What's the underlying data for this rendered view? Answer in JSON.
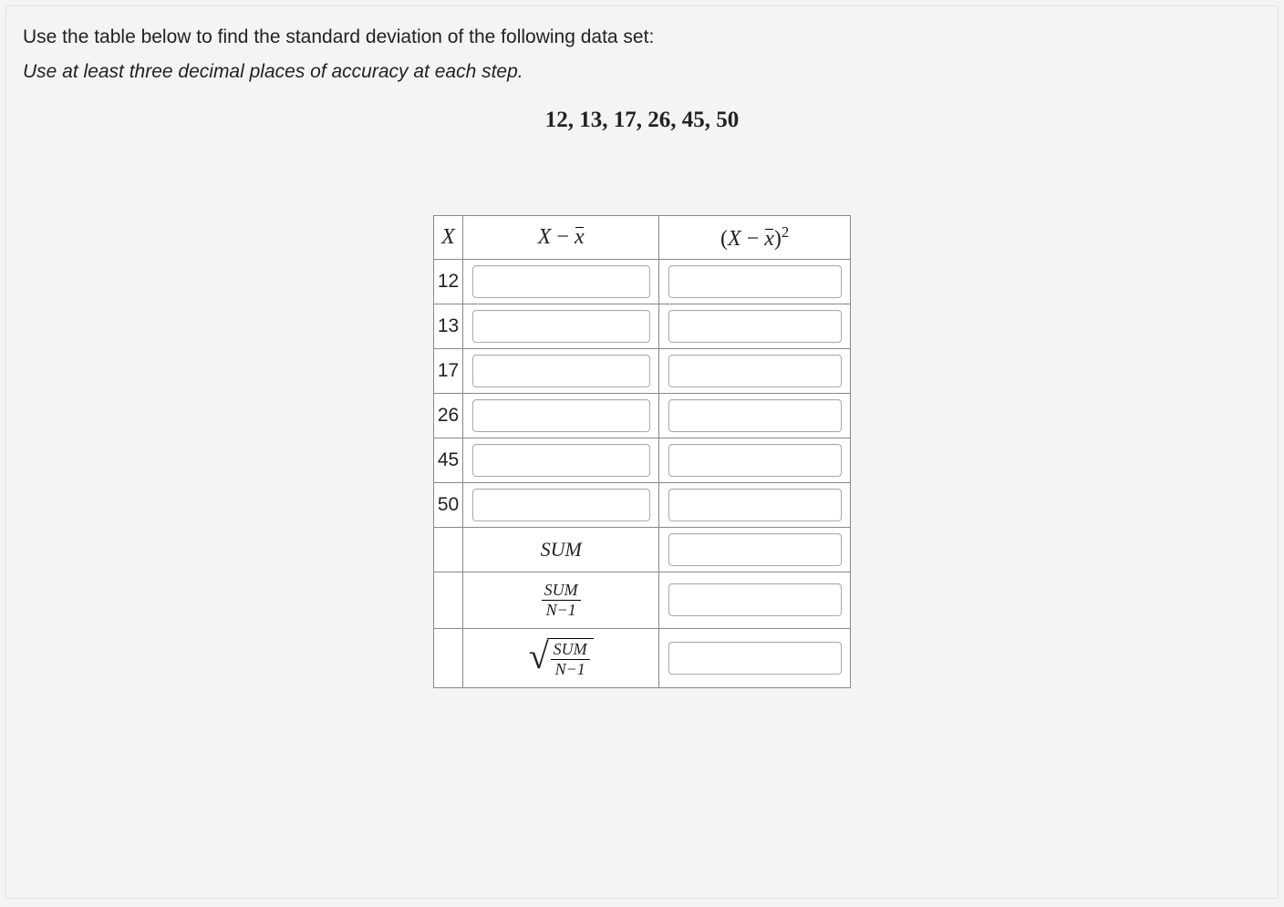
{
  "prompt": {
    "line1": "Use the table below to find the standard deviation of the following data set:",
    "instruction": "Use at least three decimal places of accuracy at each step.",
    "dataset": "12, 13, 17, 26, 45, 50"
  },
  "table": {
    "headers": {
      "x": "X",
      "dev_left": "X",
      "dev_minus": " − ",
      "dev_xbar": "x̄",
      "sq_open": "(",
      "sq_left": "X",
      "sq_minus": " − ",
      "sq_xbar": "x̄",
      "sq_close": ")",
      "sq_exp": "2"
    },
    "rows": [
      {
        "x": "12",
        "dev": "",
        "sq": ""
      },
      {
        "x": "13",
        "dev": "",
        "sq": ""
      },
      {
        "x": "17",
        "dev": "",
        "sq": ""
      },
      {
        "x": "26",
        "dev": "",
        "sq": ""
      },
      {
        "x": "45",
        "dev": "",
        "sq": ""
      },
      {
        "x": "50",
        "dev": "",
        "sq": ""
      }
    ],
    "summary": {
      "sum_label": "SUM",
      "frac_num": "SUM",
      "frac_den": "N−1",
      "sum_value": "",
      "variance_value": "",
      "stddev_value": ""
    }
  }
}
